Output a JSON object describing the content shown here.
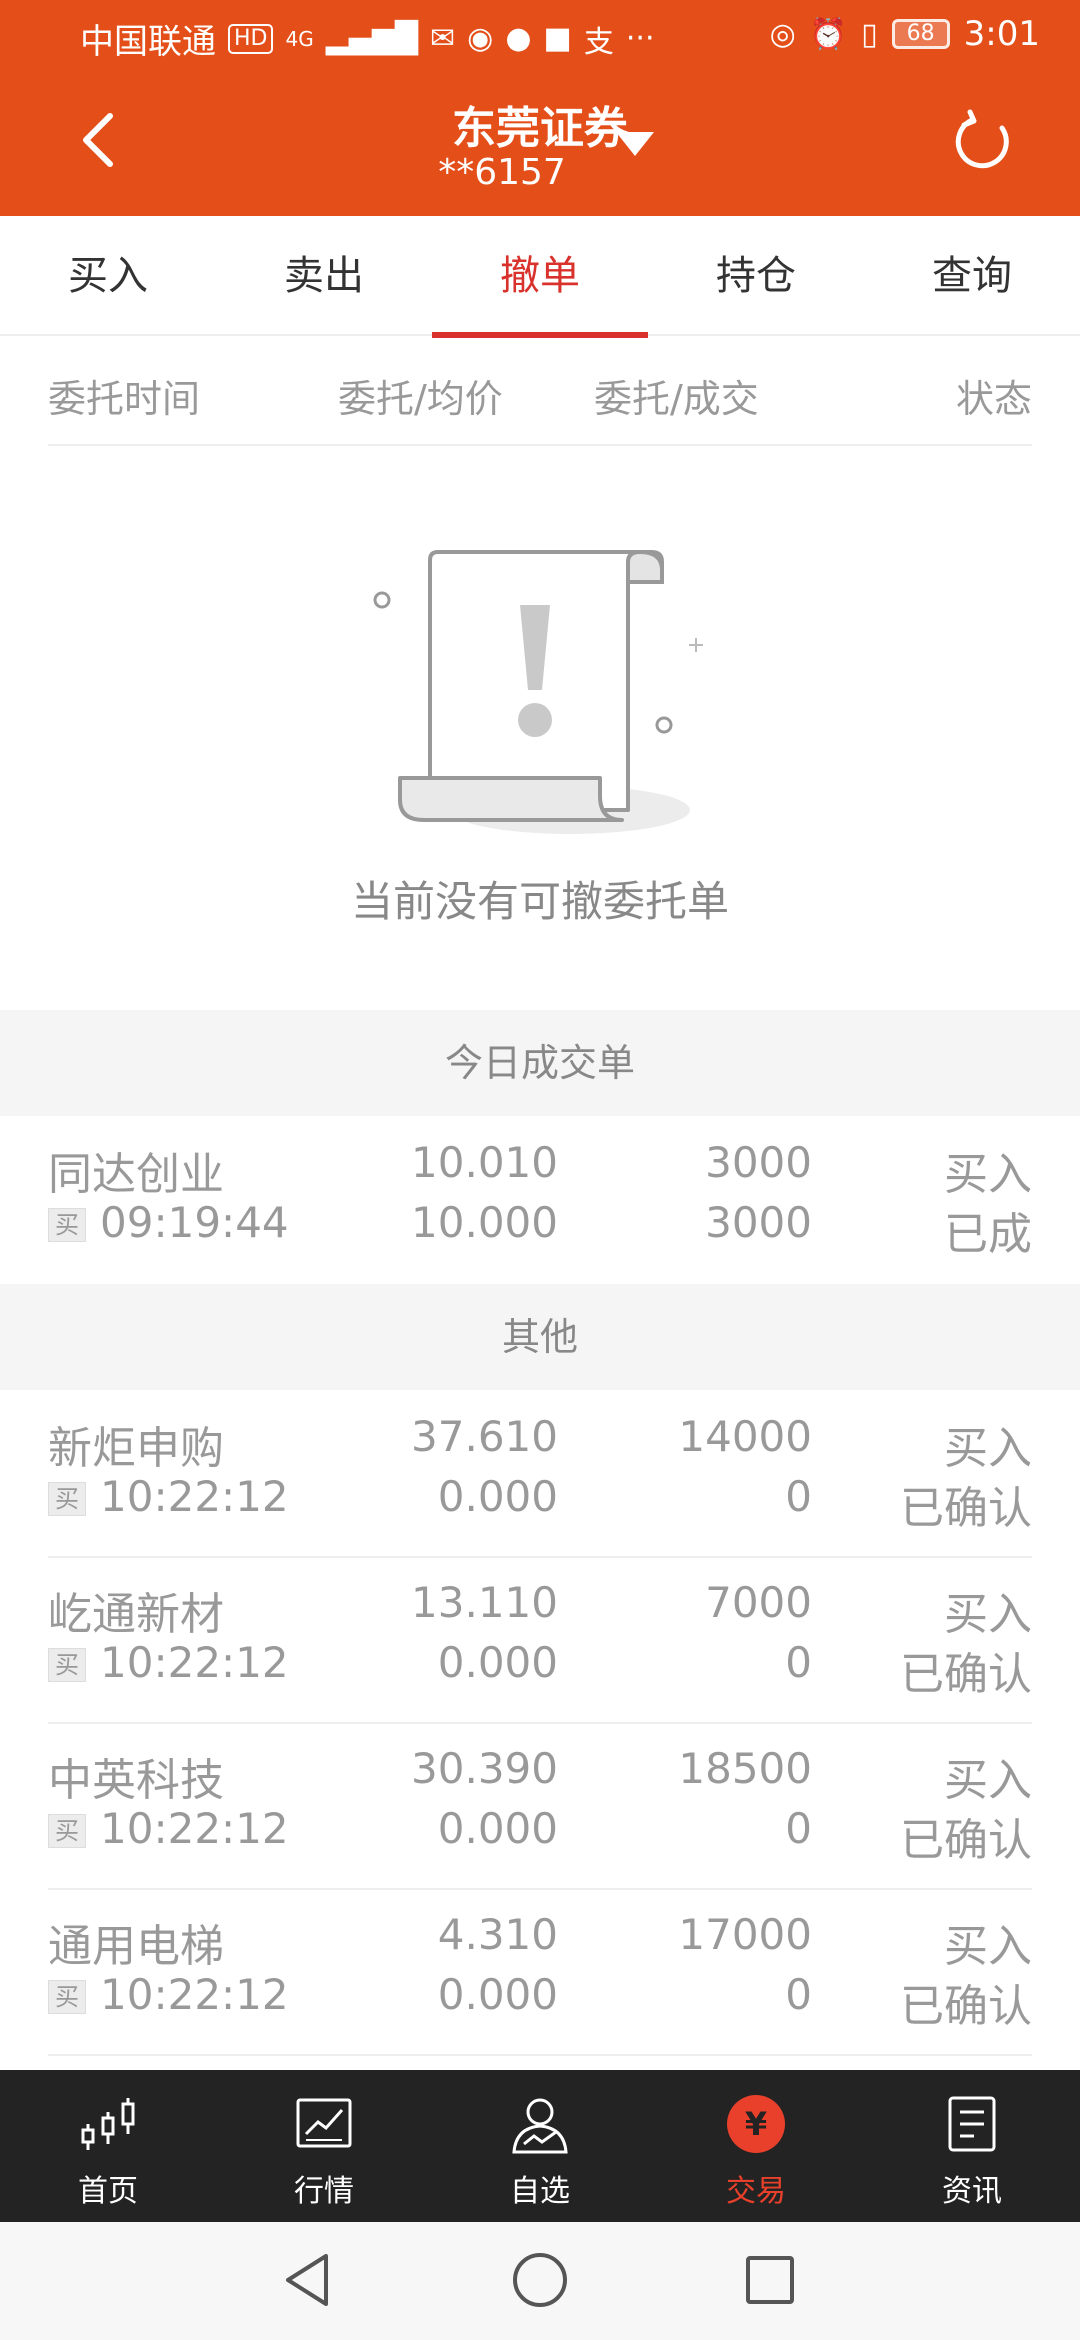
{
  "status_bar": {
    "carrier": "中国联通",
    "hd": "HD",
    "network": "4G",
    "battery": "68",
    "time": "3:01"
  },
  "header": {
    "title": "东莞证券",
    "account": "**6157"
  },
  "tabs": [
    {
      "label": "买入"
    },
    {
      "label": "卖出"
    },
    {
      "label": "撤单"
    },
    {
      "label": "持仓"
    },
    {
      "label": "查询"
    }
  ],
  "columns": [
    "委托时间",
    "委托/均价",
    "委托/成交",
    "状态"
  ],
  "empty_state": {
    "message": "当前没有可撤委托单"
  },
  "today_trades": {
    "title": "今日成交单",
    "rows": [
      {
        "name": "同达创业",
        "tag": "买",
        "time": "09:19:44",
        "price1": "10.010",
        "price2": "10.000",
        "qty1": "3000",
        "qty2": "3000",
        "status1": "买入",
        "status2": "已成"
      }
    ]
  },
  "others": {
    "title": "其他",
    "rows": [
      {
        "name": "新炬申购",
        "tag": "买",
        "time": "10:22:12",
        "price1": "37.610",
        "price2": "0.000",
        "qty1": "14000",
        "qty2": "0",
        "status1": "买入",
        "status2": "已确认"
      },
      {
        "name": "屹通新材",
        "tag": "买",
        "time": "10:22:12",
        "price1": "13.110",
        "price2": "0.000",
        "qty1": "7000",
        "qty2": "0",
        "status1": "买入",
        "status2": "已确认"
      },
      {
        "name": "中英科技",
        "tag": "买",
        "time": "10:22:12",
        "price1": "30.390",
        "price2": "0.000",
        "qty1": "18500",
        "qty2": "0",
        "status1": "买入",
        "status2": "已确认"
      },
      {
        "name": "通用电梯",
        "tag": "买",
        "time": "10:22:12",
        "price1": "4.310",
        "price2": "0.000",
        "qty1": "17000",
        "qty2": "0",
        "status1": "买入",
        "status2": "已确认"
      }
    ]
  },
  "bottom_nav": [
    {
      "label": "首页",
      "icon": "candlestick-icon"
    },
    {
      "label": "行情",
      "icon": "chart-icon"
    },
    {
      "label": "自选",
      "icon": "user-chart-icon"
    },
    {
      "label": "交易",
      "icon": "yuan-icon"
    },
    {
      "label": "资讯",
      "icon": "news-icon"
    }
  ],
  "colors": {
    "brand": "#E44E19",
    "active_tab": "#D9312B",
    "nav_bg": "#232323"
  }
}
